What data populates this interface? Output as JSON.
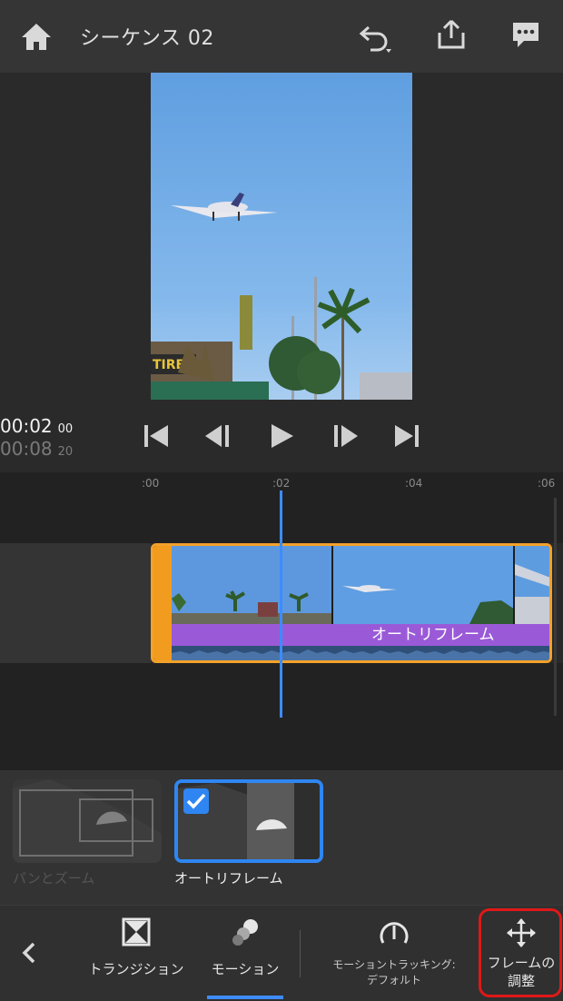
{
  "header": {
    "title": "シーケンス 02",
    "icons": [
      "home-icon",
      "undo-icon",
      "share-icon",
      "feedback-icon"
    ]
  },
  "timecode": {
    "current": "00:02",
    "current_frames": "00",
    "total": "00:08",
    "total_frames": "20"
  },
  "transport": {
    "icons": [
      "skip-to-start-icon",
      "step-back-icon",
      "play-icon",
      "step-forward-icon",
      "skip-to-end-icon"
    ]
  },
  "timeline": {
    "ticks": [
      ":00",
      ":02",
      ":04",
      ":06"
    ],
    "clip_effect_label": "オートリフレーム"
  },
  "effects": {
    "pan_zoom_label": "パンとズーム",
    "auto_reframe_label": "オートリフレーム"
  },
  "bottombar": {
    "transition_label": "トランジション",
    "motion_label": "モーション",
    "tracking_line1": "モーショントラッキング:",
    "tracking_line2": "デフォルト",
    "frame_adjust_line1": "フレームの",
    "frame_adjust_line2": "調整"
  },
  "colors": {
    "accent": "#2f86f2",
    "playhead": "#3d8cff",
    "clip_border": "#f2a12a",
    "effect_bar": "#9a5ad8",
    "highlight": "#e01818"
  }
}
